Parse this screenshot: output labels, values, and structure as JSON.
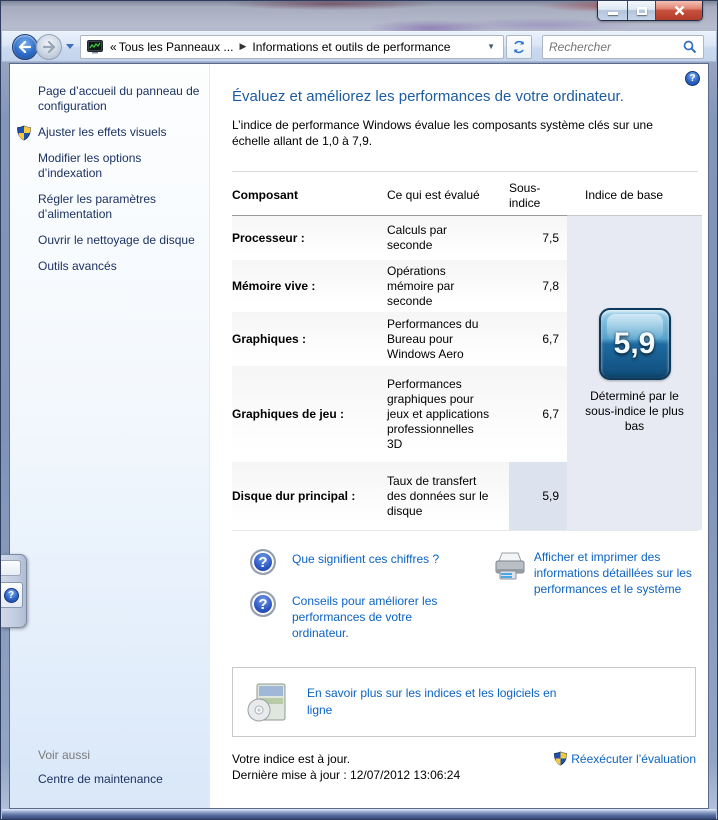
{
  "window": {
    "caption": ""
  },
  "navigation": {
    "guillemet": "«",
    "breadcrumb_items": [
      "Tous les Panneaux ...",
      "Informations et outils de performance"
    ],
    "separator_glyph": "▶",
    "dropdown_glyph": "▼",
    "search_placeholder": "Rechercher"
  },
  "icons": {
    "help_glyph": "?",
    "question_glyph": "?"
  },
  "sidebar": {
    "items": [
      {
        "label": "Page d’accueil du panneau de configuration",
        "shield": false
      },
      {
        "label": "Ajuster les effets visuels",
        "shield": true
      },
      {
        "label": "Modifier les options d’indexation",
        "shield": false
      },
      {
        "label": "Régler les paramètres d’alimentation",
        "shield": false
      },
      {
        "label": "Ouvrir le nettoyage de disque",
        "shield": false
      },
      {
        "label": "Outils avancés",
        "shield": false
      }
    ],
    "see_also_header": "Voir aussi",
    "see_also_link": "Centre de maintenance"
  },
  "main": {
    "title": "Évaluez et améliorez les performances de votre ordinateur.",
    "description": "L’indice de performance Windows évalue les composants système clés sur une échelle allant de 1,0 à 7,9.",
    "table": {
      "headers": [
        "Composant",
        "Ce qui est évalué",
        "Sous-indice",
        "Indice de base"
      ],
      "rows": [
        {
          "component": "Processeur :",
          "evaluated": "Calculs par seconde",
          "score": "7,5",
          "highlight": false
        },
        {
          "component": "Mémoire vive :",
          "evaluated": "Opérations mémoire par seconde",
          "score": "7,8",
          "highlight": false
        },
        {
          "component": "Graphiques :",
          "evaluated": "Performances du Bureau pour Windows Aero",
          "score": "6,7",
          "highlight": false
        },
        {
          "component": "Graphiques de jeu :",
          "evaluated": "Performances graphiques pour jeux et applications professionnelles 3D",
          "score": "6,7",
          "highlight": false
        },
        {
          "component": "Disque dur principal :",
          "evaluated": "Taux de transfert des données sur le disque",
          "score": "5,9",
          "highlight": true
        }
      ],
      "base_score": "5,9",
      "base_score_caption": "Déterminé par le sous-indice le plus bas"
    },
    "links": {
      "what_do_numbers_mean": "Que signifient ces chiffres ?",
      "improve_tips": "Conseils pour améliorer les performances de votre ordinateur.",
      "print_details": "Afficher et imprimer des informations détaillées sur les performances et le système",
      "learn_more": "En savoir plus sur les indices et les logiciels en ligne",
      "rerun_assessment": "Réexécuter l’évaluation"
    },
    "status": {
      "up_to_date": "Votre indice est à jour.",
      "last_update": "Dernière mise à jour : 12/07/2012 13:06:24"
    }
  },
  "colors": {
    "title_blue": "#1d5c9e",
    "link_blue": "#0b63c5",
    "sidebar_link": "#1c3263",
    "badge_top": "#9ed2ec",
    "badge_bottom": "#0f4c7b",
    "base_column_bg": "#e7eaf2",
    "highlight_cell_bg": "#dce2ee",
    "close_button_red": "#b53d2a"
  }
}
